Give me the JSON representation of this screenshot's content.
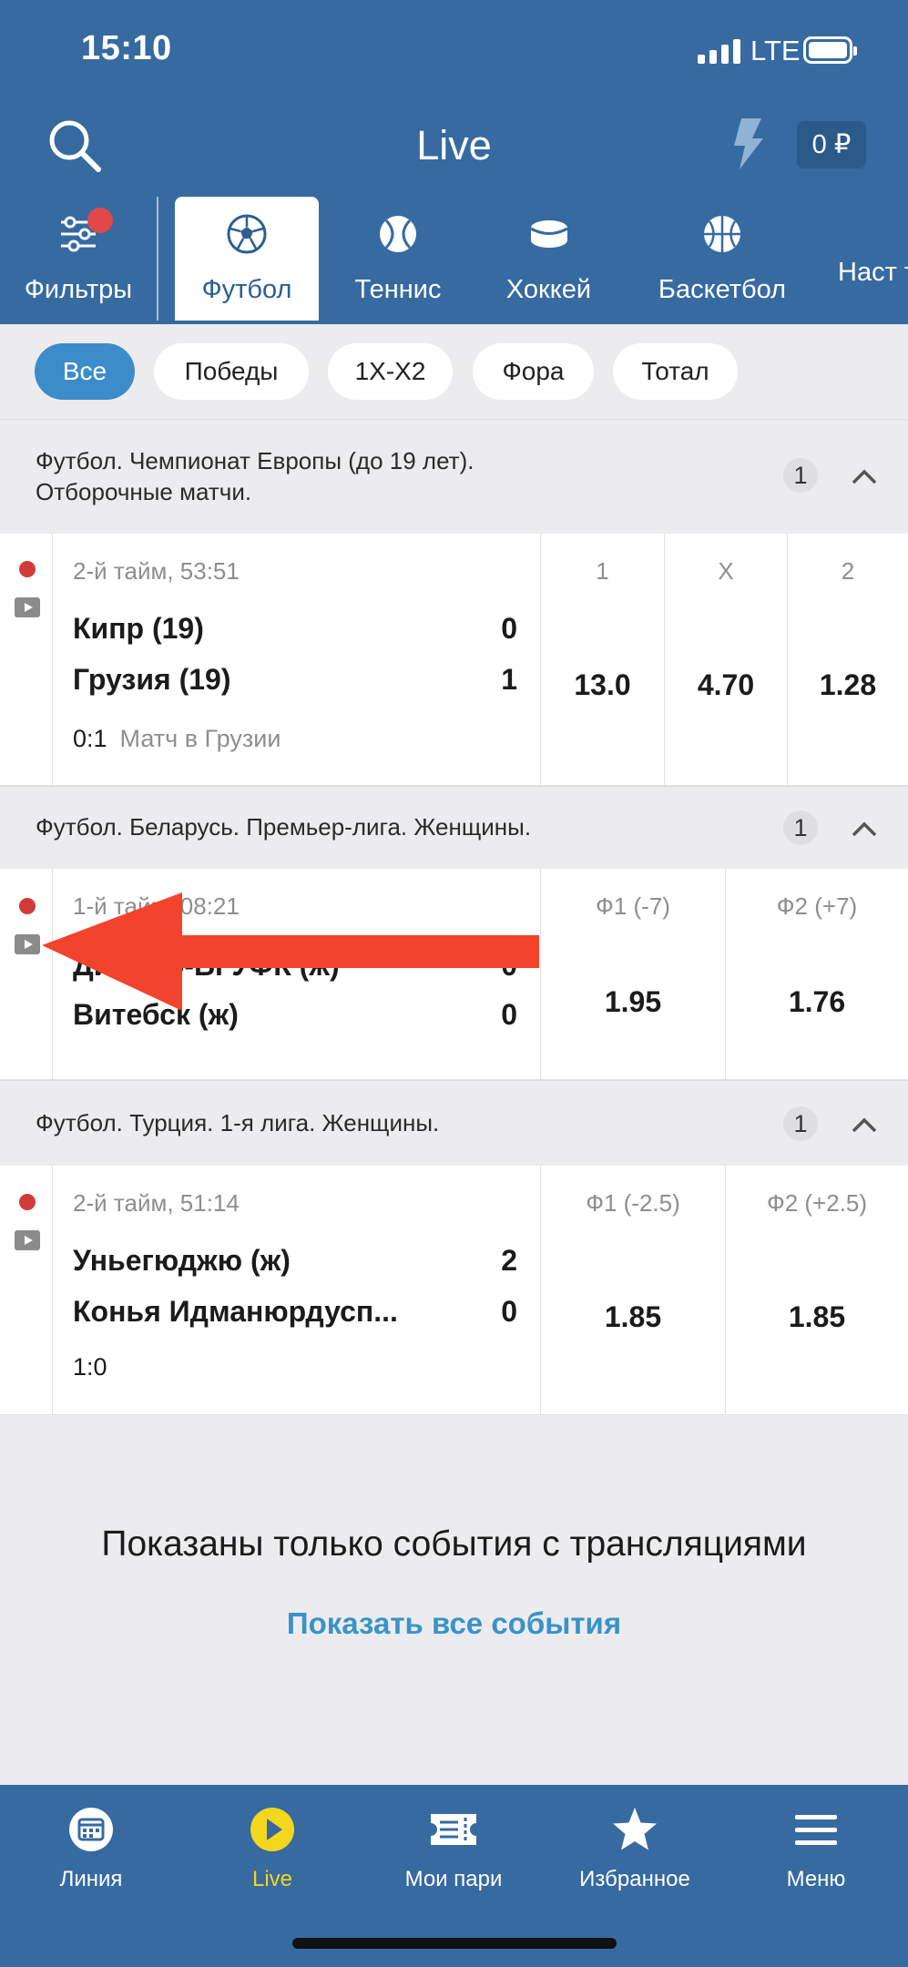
{
  "status_bar": {
    "time": "15:10",
    "network": "LTE"
  },
  "header": {
    "title": "Live",
    "balance": "0 ₽"
  },
  "sports": [
    {
      "label": "Фильтры",
      "icon": "filters-icon"
    },
    {
      "label": "Футбол",
      "icon": "football-icon",
      "active": true
    },
    {
      "label": "Теннис",
      "icon": "tennis-icon"
    },
    {
      "label": "Хоккей",
      "icon": "hockey-icon"
    },
    {
      "label": "Баскетбол",
      "icon": "basketball-icon"
    },
    {
      "label": "Наст те",
      "icon": "settings-icon"
    }
  ],
  "chips": [
    "Все",
    "Победы",
    "1X-X2",
    "Фора",
    "Тотал"
  ],
  "sections": [
    {
      "title_line1": "Футбол. Чемпионат Европы (до 19 лет).",
      "title_line2": "Отборочные матчи.",
      "count": "1",
      "match": {
        "time": "2-й тайм, 53:51",
        "team1": "Кипр (19)",
        "score1": "0",
        "team2": "Грузия (19)",
        "score2": "1",
        "extra_score": "0:1",
        "extra_note": "Матч в Грузии",
        "odds": [
          {
            "label": "1",
            "value": "13.0"
          },
          {
            "label": "X",
            "value": "4.70"
          },
          {
            "label": "2",
            "value": "1.28"
          }
        ]
      }
    },
    {
      "title_line1": "Футбол. Беларусь. Премьер-лига. Женщины.",
      "count": "1",
      "match": {
        "time": "1-й тайм, 08:21",
        "team1": "Динамо-БГУФК (ж)",
        "score1": "0",
        "team2": "Витебск (ж)",
        "score2": "0",
        "odds": [
          {
            "label": "Ф1 (-7)",
            "value": "1.95"
          },
          {
            "label": "Ф2 (+7)",
            "value": "1.76"
          }
        ]
      }
    },
    {
      "title_line1": "Футбол. Турция. 1-я лига. Женщины.",
      "count": "1",
      "match": {
        "time": "2-й тайм, 51:14",
        "team1": "Уньегюджю (ж)",
        "score1": "2",
        "team2": "Конья Идманюрдусп...",
        "score2": "0",
        "extra_score": "1:0",
        "odds": [
          {
            "label": "Ф1 (-2.5)",
            "value": "1.85"
          },
          {
            "label": "Ф2 (+2.5)",
            "value": "1.85"
          }
        ]
      }
    }
  ],
  "info": {
    "text": "Показаны только события с трансляциями",
    "link": "Показать все события"
  },
  "tabbar": [
    {
      "label": "Линия",
      "icon": "calendar-icon"
    },
    {
      "label": "Live",
      "icon": "play-icon",
      "active": true
    },
    {
      "label": "Мои пари",
      "icon": "ticket-icon"
    },
    {
      "label": "Избранное",
      "icon": "star-icon"
    },
    {
      "label": "Меню",
      "icon": "menu-icon"
    }
  ],
  "colors": {
    "header_bg": "#366aa0",
    "accent": "#3d8cca",
    "live_dot": "#d23a3a",
    "arrow": "#f2432c",
    "active_tab": "#f4d71d"
  }
}
